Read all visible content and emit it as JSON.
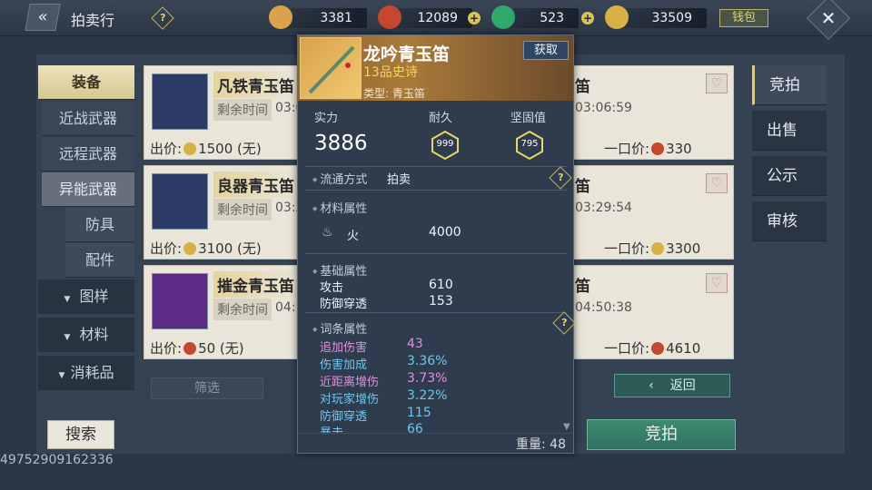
{
  "topbar": {
    "title": "拍卖行",
    "currencies": [
      {
        "icon": "gold-coin-icon",
        "value": "3381",
        "color": "#d9a24c"
      },
      {
        "icon": "red-token-icon",
        "value": "12089",
        "color": "#c4472f"
      },
      {
        "icon": "jade-icon",
        "value": "523",
        "color": "#2fa86a"
      },
      {
        "icon": "gold-leaf-icon",
        "value": "33509",
        "color": "#d7b145"
      }
    ],
    "money_bag_label": "钱包"
  },
  "sidebar": {
    "items": [
      {
        "label": "装备"
      },
      {
        "label": "近战武器"
      },
      {
        "label": "远程武器"
      },
      {
        "label": "异能武器"
      },
      {
        "label": "防具"
      },
      {
        "label": "配件"
      },
      {
        "label": "图样"
      },
      {
        "label": "材料"
      },
      {
        "label": "消耗品"
      }
    ]
  },
  "listings": [
    {
      "name": "凡铁青玉笛",
      "time_label": "剩余时间",
      "time_left": "03:0",
      "right_name": "笛",
      "right_time": "03:06:59",
      "bid_label": "出价:",
      "bid": "1500 (无)",
      "buy_label": "一口价:",
      "buy": "330",
      "bid_coin": "#d7b145",
      "buy_coin": "#c4472f",
      "icon_bg": "#2c3c66"
    },
    {
      "name": "良器青玉笛",
      "time_label": "剩余时间",
      "time_left": "03:2",
      "right_name": "笛",
      "right_time": "03:29:54",
      "bid_label": "出价:",
      "bid": "3100 (无)",
      "buy_label": "一口价:",
      "buy": "3300",
      "bid_coin": "#d7b145",
      "buy_coin": "#d7b145",
      "icon_bg": "#2c3c66"
    },
    {
      "name": "摧金青玉笛",
      "time_label": "剩余时间",
      "time_left": "04:",
      "right_name": "笛",
      "right_time": "04:50:38",
      "bid_label": "出价:",
      "bid": "50 (无)",
      "buy_label": "一口价:",
      "buy": "4610",
      "bid_coin": "#c4472f",
      "buy_coin": "#c4472f",
      "icon_bg": "#5b2b86"
    }
  ],
  "filter_label": "筛选",
  "return_label": "返回",
  "search_label": "搜索",
  "bid_button_label": "竞拍",
  "tabs": [
    {
      "label": "竞拍"
    },
    {
      "label": "出售"
    },
    {
      "label": "公示"
    },
    {
      "label": "审核"
    }
  ],
  "bottom_id": "49752909162336",
  "popup": {
    "name": "龙吟青玉笛",
    "grade": "13品史诗",
    "type": "类型: 青玉笛",
    "acquire_label": "获取",
    "power_label": "实力",
    "power": "3886",
    "durability_label": "耐久",
    "durability": "999",
    "toughness_label": "坚固值",
    "toughness": "795",
    "circulation_label": "流通方式",
    "circulation": "拍卖",
    "material_label": "材料属性",
    "material_attr": {
      "name": "火",
      "value": "4000"
    },
    "base_label": "基础属性",
    "base_attrs": [
      {
        "name": "攻击",
        "value": "610"
      },
      {
        "name": "防御穿透",
        "value": "153"
      }
    ],
    "affix_label": "词条属性",
    "affixes": [
      {
        "name": "追加伤害",
        "value": "43",
        "color": "#e08ee0"
      },
      {
        "name": "伤害加成",
        "value": "3.36%",
        "color": "#6ec6f0"
      },
      {
        "name": "近距离增伤",
        "value": "3.73%",
        "color": "#e08ee0"
      },
      {
        "name": "对玩家增伤",
        "value": "3.22%",
        "color": "#6ec6f0"
      },
      {
        "name": "防御穿透",
        "value": "115",
        "color": "#6ec6f0"
      },
      {
        "name": "暴击",
        "value": "66",
        "color": "#6ec6f0"
      }
    ],
    "weight_label": "重量: 48"
  }
}
